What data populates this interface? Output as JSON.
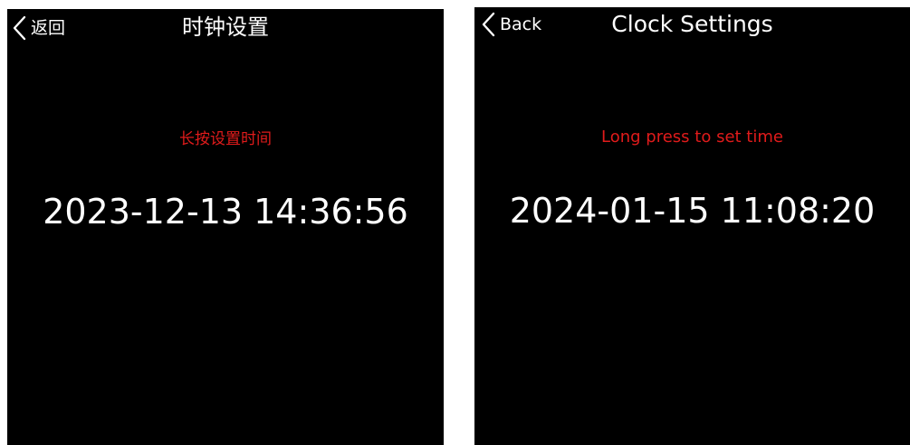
{
  "screens": [
    {
      "back_label": "返回",
      "title": "时钟设置",
      "hint": "长按设置时间",
      "datetime": "2023-12-13 14:36:56"
    },
    {
      "back_label": "Back",
      "title": "Clock Settings",
      "hint": "Long press to set time",
      "datetime": "2024-01-15 11:08:20"
    }
  ],
  "icons": {
    "back": "chevron-left-icon"
  },
  "colors": {
    "background": "#000000",
    "text": "#ffffff",
    "hint": "#e01b1b"
  }
}
